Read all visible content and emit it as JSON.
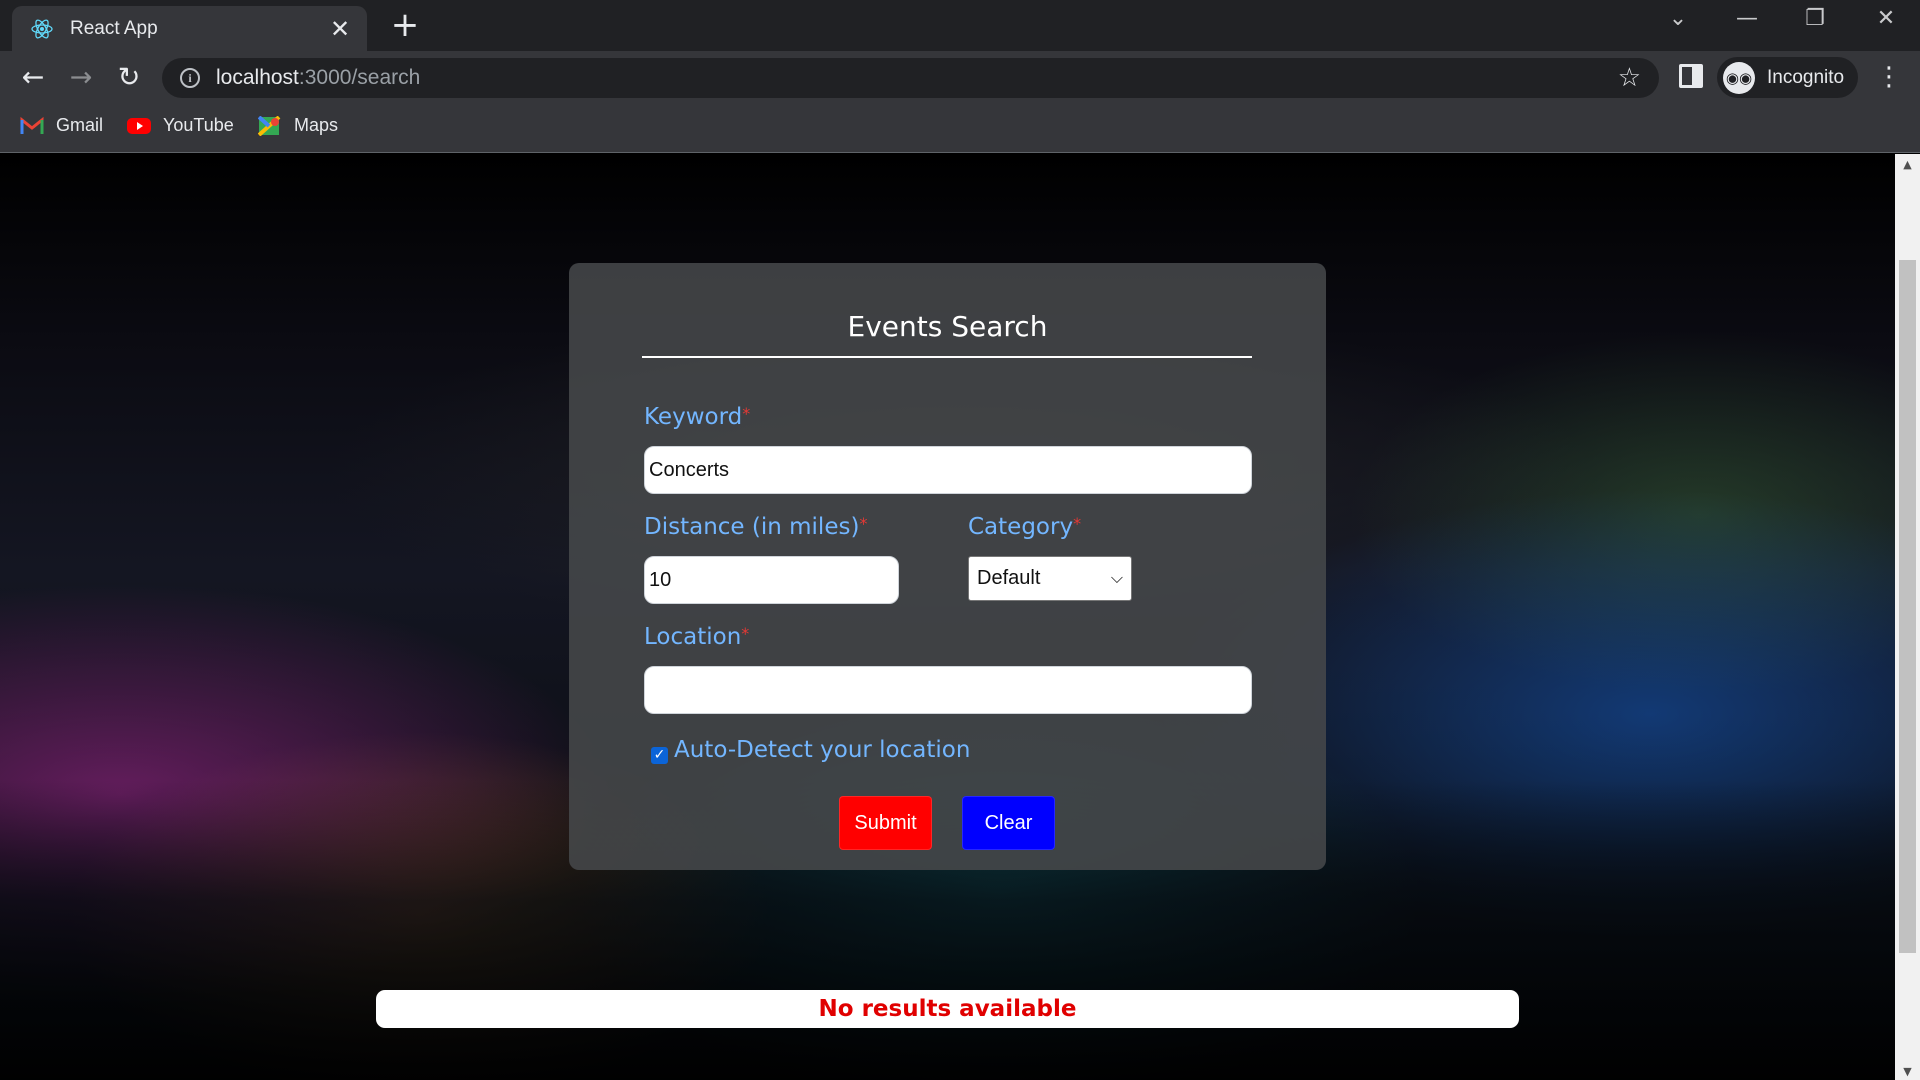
{
  "browser": {
    "tab": {
      "title": "React App",
      "favicon": "react-icon"
    },
    "url": {
      "host": "localhost",
      "rest": ":3000/search"
    },
    "profile_label": "Incognito",
    "bookmarks": [
      {
        "label": "Gmail",
        "icon": "gmail-icon"
      },
      {
        "label": "YouTube",
        "icon": "youtube-icon"
      },
      {
        "label": "Maps",
        "icon": "maps-icon"
      }
    ]
  },
  "form": {
    "title": "Events Search",
    "keyword": {
      "label": "Keyword",
      "required_mark": "*",
      "value": "Concerts"
    },
    "distance": {
      "label": "Distance (in miles)",
      "required_mark": "*",
      "value": "10"
    },
    "category": {
      "label": "Category",
      "required_mark": "*",
      "selected": "Default"
    },
    "location": {
      "label": "Location",
      "required_mark": "*",
      "value": ""
    },
    "auto_detect": {
      "label": "Auto-Detect your location",
      "checked": true
    },
    "submit_label": "Submit",
    "clear_label": "Clear"
  },
  "results": {
    "message": "No results available"
  },
  "colors": {
    "label_blue": "#73b6ff",
    "required_red": "#e53935",
    "submit_bg": "#ff0000",
    "clear_bg": "#0000ff",
    "no_results_text": "#e00000"
  }
}
